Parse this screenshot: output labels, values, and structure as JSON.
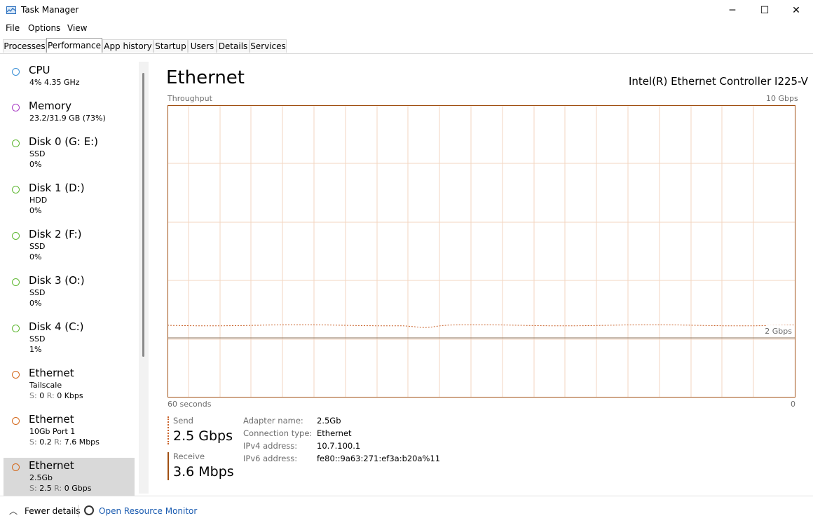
{
  "window": {
    "title": "Task Manager",
    "minimize": "─",
    "maximize": "☐",
    "close": "✕"
  },
  "menus": [
    "File",
    "Options",
    "View"
  ],
  "tabs": [
    "Processes",
    "Performance",
    "App history",
    "Startup",
    "Users",
    "Details",
    "Services"
  ],
  "active_tab": "Performance",
  "sidebar": [
    {
      "title": "CPU",
      "line1": "4%  4.35 GHz",
      "line2": "",
      "color": "#3a8fd6"
    },
    {
      "title": "Memory",
      "line1": "23.2/31.9 GB (73%)",
      "line2": "",
      "color": "#a83ac4"
    },
    {
      "title": "Disk 0 (G: E:)",
      "line1": "SSD",
      "line2": "0%",
      "color": "#5fb832"
    },
    {
      "title": "Disk 1 (D:)",
      "line1": "HDD",
      "line2": "0%",
      "color": "#5fb832"
    },
    {
      "title": "Disk 2 (F:)",
      "line1": "SSD",
      "line2": "0%",
      "color": "#5fb832"
    },
    {
      "title": "Disk 3 (O:)",
      "line1": "SSD",
      "line2": "0%",
      "color": "#5fb832"
    },
    {
      "title": "Disk 4 (C:)",
      "line1": "SSD",
      "line2": "1%",
      "color": "#5fb832"
    },
    {
      "title": "Ethernet",
      "line1": "Tailscale",
      "line2_s": "S:",
      "line2_sv": " 0 ",
      "line2_r": "R:",
      "line2_rv": " 0 Kbps",
      "color": "#d4691c"
    },
    {
      "title": "Ethernet",
      "line1": "10Gb Port 1",
      "line2_s": "S:",
      "line2_sv": " 0.2 ",
      "line2_r": "R:",
      "line2_rv": " 7.6 Mbps",
      "color": "#d4691c"
    },
    {
      "title": "Ethernet",
      "line1": "2.5Gb",
      "line2_s": "S:",
      "line2_sv": " 2.5 ",
      "line2_r": "R:",
      "line2_rv": " 0 Gbps",
      "color": "#d4691c"
    }
  ],
  "main": {
    "title": "Ethernet",
    "adapter": "Intel(R) Ethernet Controller I225-V",
    "throughput_label": "Throughput",
    "max_label": "10 Gbps",
    "line_label": "2 Gbps",
    "time_left": "60 seconds",
    "time_right": "0",
    "graph_color": "#a04f12",
    "grid_color": "#f3d5c0"
  },
  "stats": {
    "send_label": "Send",
    "send_value": "2.5 Gbps",
    "receive_label": "Receive",
    "receive_value": "3.6 Mbps"
  },
  "properties": [
    {
      "label": "Adapter name:",
      "value": "2.5Gb"
    },
    {
      "label": "Connection type:",
      "value": "Ethernet"
    },
    {
      "label": "IPv4 address:",
      "value": "10.7.100.1"
    },
    {
      "label": "IPv6 address:",
      "value": "fe80::9a63:271:ef3a:b20a%11"
    }
  ],
  "footer": {
    "fewer_details": "Fewer details",
    "open_rm": "Open Resource Monitor"
  }
}
